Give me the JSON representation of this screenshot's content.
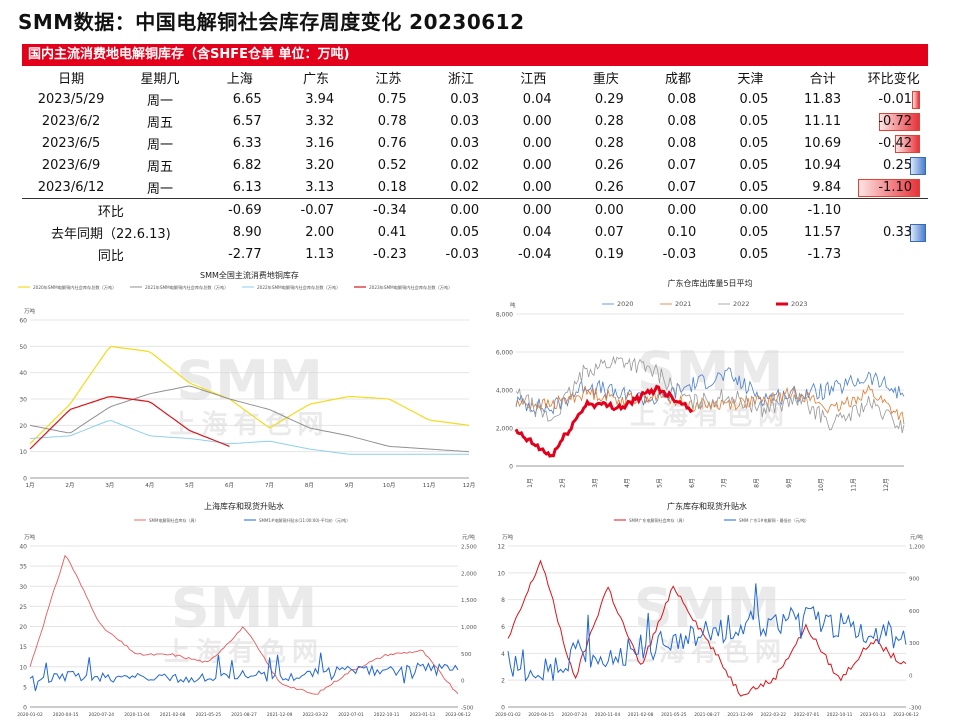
{
  "title": "SMM数据：中国电解铜社会库存周度变化 20230612",
  "table_title": "国内主流消费地电解铜库存（含SHFE仓单 单位：万吨)",
  "headers": [
    "日期",
    "星期几",
    "上海",
    "广东",
    "江苏",
    "浙江",
    "江西",
    "重庆",
    "成都",
    "天津",
    "合计",
    "环比变化"
  ],
  "rows": [
    {
      "date": "2023/5/29",
      "weekday": "周一",
      "vals": [
        "6.65",
        "3.94",
        "0.75",
        "0.03",
        "0.04",
        "0.29",
        "0.08",
        "0.05",
        "11.83"
      ],
      "chg": "-0.01",
      "chg_value": -0.01
    },
    {
      "date": "2023/6/2",
      "weekday": "周五",
      "vals": [
        "6.57",
        "3.32",
        "0.78",
        "0.03",
        "0.00",
        "0.28",
        "0.08",
        "0.05",
        "11.11"
      ],
      "chg": "-0.72",
      "chg_value": -0.72
    },
    {
      "date": "2023/6/5",
      "weekday": "周一",
      "vals": [
        "6.33",
        "3.16",
        "0.76",
        "0.03",
        "0.00",
        "0.28",
        "0.08",
        "0.05",
        "10.69"
      ],
      "chg": "-0.42",
      "chg_value": -0.42
    },
    {
      "date": "2023/6/9",
      "weekday": "周五",
      "vals": [
        "6.82",
        "3.20",
        "0.52",
        "0.02",
        "0.00",
        "0.26",
        "0.07",
        "0.05",
        "10.94"
      ],
      "chg": "0.25",
      "chg_value": 0.25
    },
    {
      "date": "2023/6/12",
      "weekday": "周一",
      "vals": [
        "6.13",
        "3.13",
        "0.18",
        "0.02",
        "0.00",
        "0.26",
        "0.07",
        "0.05",
        "9.84"
      ],
      "chg": "-1.10",
      "chg_value": -1.1
    }
  ],
  "summary": [
    {
      "label": "环比",
      "vals": [
        "-0.69",
        "-0.07",
        "-0.34",
        "0.00",
        "0.00",
        "0.00",
        "0.00",
        "0.00",
        "-1.10"
      ],
      "chg": "",
      "chg_value": null
    },
    {
      "label": "去年同期（22.6.13)",
      "vals": [
        "8.90",
        "2.00",
        "0.41",
        "0.05",
        "0.04",
        "0.07",
        "0.10",
        "0.05",
        "11.57"
      ],
      "chg": "0.33",
      "chg_value": 0.33
    },
    {
      "label": "同比",
      "vals": [
        "-2.77",
        "1.13",
        "-0.23",
        "-0.03",
        "-0.04",
        "0.19",
        "-0.03",
        "0.05",
        "-1.73"
      ],
      "chg": "",
      "chg_value": null
    }
  ],
  "colors": {
    "red_bar": "#e3001b",
    "neg": "#e8323a",
    "pos": "#4a7fd0"
  },
  "watermark": {
    "logo": "SMM",
    "sub": "上海有色网"
  },
  "chart_data": [
    {
      "type": "line",
      "title": "SMM全国主流消费地铜库存",
      "ylabel": "万吨",
      "ylim": [
        0,
        60
      ],
      "yticks": [
        "0",
        "10",
        "20",
        "30",
        "40",
        "50",
        "60"
      ],
      "categories": [
        "1月",
        "2月",
        "3月",
        "4月",
        "5月",
        "6月",
        "7月",
        "8月",
        "9月",
        "10月",
        "11月",
        "12月"
      ],
      "series": [
        {
          "name": "2020年SMM电解铜内社会库存总数（万吨）",
          "color": "#f2dc1e",
          "values": [
            13,
            28,
            50,
            48,
            36,
            30,
            19,
            28,
            31,
            30,
            22,
            20
          ]
        },
        {
          "name": "2021年SMM电解铜内社会库存总数（万吨）",
          "color": "#909090",
          "values": [
            20,
            17,
            27,
            32,
            35,
            30,
            26,
            19,
            16,
            12,
            11,
            10
          ]
        },
        {
          "name": "2022年SMM电解铜内社会库存总数（万吨）",
          "color": "#8ed0ec",
          "values": [
            15,
            16,
            22,
            16,
            15,
            13,
            14,
            11,
            9,
            9,
            9,
            9
          ]
        },
        {
          "name": "2023年SMM电解铜内社会库存总数（万吨）",
          "color": "#d9151b",
          "values": [
            11,
            26,
            31,
            29,
            18,
            12
          ]
        }
      ]
    },
    {
      "type": "line",
      "title": "广东仓库出库量5日平均",
      "ylabel": "吨",
      "ylim": [
        0,
        8000
      ],
      "yticks": [
        "0",
        "2,000",
        "4,000",
        "6,000",
        "8,000"
      ],
      "categories": [
        "1月",
        "2月",
        "3月",
        "4月",
        "5月",
        "6月",
        "7月",
        "8月",
        "9月",
        "10月",
        "11月",
        "12月"
      ],
      "series": [
        {
          "name": "2020",
          "color": "#4a7fd0",
          "values": [
            3400,
            3000,
            4300,
            3700,
            3500,
            4300,
            4800,
            3600,
            3800,
            4000,
            4700,
            3700
          ]
        },
        {
          "name": "2021",
          "color": "#e07a2e",
          "values": [
            3300,
            3200,
            3900,
            3500,
            3700,
            3200,
            3300,
            3400,
            3900,
            2900,
            4000,
            2500
          ]
        },
        {
          "name": "2022",
          "color": "#999999",
          "values": [
            3800,
            2400,
            5100,
            5600,
            4900,
            3300,
            3700,
            3000,
            3500,
            2200,
            3300,
            2000
          ]
        },
        {
          "name": "2023",
          "color": "#e3001b",
          "values": [
            1800,
            500,
            3300,
            3100,
            4100,
            3000
          ]
        }
      ]
    },
    {
      "type": "line",
      "title": "上海库存和现货升贴水",
      "ylabel": "万吨",
      "ylabel2": "元/吨",
      "ylim": [
        0,
        40
      ],
      "ylim2": [
        -500,
        2500
      ],
      "yticks": [
        "0",
        "5",
        "10",
        "15",
        "20",
        "25",
        "30",
        "35",
        "40"
      ],
      "yticks2": [
        "-500",
        "0",
        "500",
        "1,000",
        "1,500",
        "2,000",
        "2,500"
      ],
      "categories": [
        "2020-01-02",
        "2020-04-15",
        "2020-07-24",
        "2020-11-04",
        "2021-02-08",
        "2021-05-25",
        "2021-08-27",
        "2021-12-09",
        "2022-03-22",
        "2022-07-01",
        "2022-10-11",
        "2023-01-13",
        "2023-06-12"
      ],
      "series": [
        {
          "name": "SMM电解铜社会库存（周）",
          "color": "#e85a5a",
          "values": [
            10,
            38,
            20,
            13,
            13,
            11,
            20,
            6,
            3,
            9,
            13,
            14,
            3
          ]
        },
        {
          "name": "SMM1#电解铜升贴水(11:00:00)-平均价（元/吨）",
          "color": "#2166d4",
          "values": [
            0,
            80,
            60,
            40,
            20,
            50,
            120,
            40,
            150,
            200,
            160,
            240,
            260
          ]
        }
      ]
    },
    {
      "type": "line",
      "title": "广东库存和现货升贴水",
      "ylabel": "万吨",
      "ylabel2": "元/吨",
      "ylim": [
        0,
        12
      ],
      "ylim2": [
        -300,
        1200
      ],
      "yticks": [
        "0",
        "2",
        "4",
        "6",
        "8",
        "10",
        "12"
      ],
      "yticks2": [
        "-300",
        "0",
        "300",
        "600",
        "900",
        "1,200"
      ],
      "categories": [
        "2020-01-02",
        "2020-04-15",
        "2020-07-24",
        "2020-11-04",
        "2021-02-08",
        "2021-05-25",
        "2021-08-27",
        "2021-12-09",
        "2022-03-22",
        "2022-07-01",
        "2022-10-11",
        "2023-01-13",
        "2023-06-12"
      ],
      "series": [
        {
          "name": "SMM广东电解铜社会库存（周）",
          "color": "#d9151b",
          "values": [
            5,
            11,
            2,
            9,
            3,
            9,
            5,
            1,
            2,
            6,
            2,
            5,
            3
          ]
        },
        {
          "name": "SMM 广东1#电解铜 - 最低价（元/吨）",
          "color": "#2166d4",
          "values": [
            100,
            0,
            200,
            150,
            250,
            300,
            400,
            450,
            500,
            550,
            450,
            400,
            380
          ]
        }
      ]
    }
  ]
}
